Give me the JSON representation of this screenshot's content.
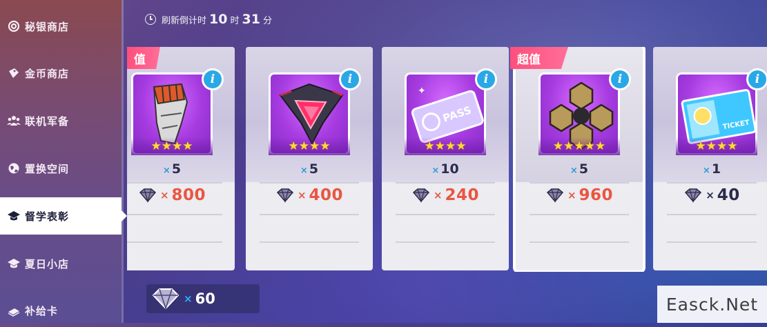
{
  "sidebar": {
    "items": [
      {
        "label": "秘银商店",
        "icon": "spiral-icon"
      },
      {
        "label": "金币商店",
        "icon": "coin-tag-icon"
      },
      {
        "label": "联机军备",
        "icon": "team-icon"
      },
      {
        "label": "置换空间",
        "icon": "globe-icon"
      },
      {
        "label": "督学表彰",
        "icon": "graduation-cap-icon",
        "active": true
      },
      {
        "label": "夏日小店",
        "icon": "graduation-cap-icon"
      },
      {
        "label": "补给卡",
        "icon": "card-stack-icon"
      }
    ]
  },
  "timer": {
    "label": "刷新倒计时",
    "hours": "10",
    "hours_unit": "时",
    "minutes": "31",
    "minutes_unit": "分"
  },
  "cards": [
    {
      "tag": "值",
      "qty_x": "×",
      "qty": "5",
      "stars": "★★★★",
      "price_x": "×",
      "price": "800",
      "item": "orange-helmet-fragment",
      "info": "i"
    },
    {
      "tag": "",
      "qty_x": "×",
      "qty": "5",
      "stars": "★★★★",
      "price_x": "×",
      "price": "400",
      "item": "red-core-device",
      "info": "i"
    },
    {
      "tag": "",
      "qty_x": "×",
      "qty": "10",
      "stars": "★★★★",
      "price_x": "×",
      "price": "240",
      "item": "pass-ticket",
      "info": "i"
    },
    {
      "tag": "超值",
      "qty_x": "×",
      "qty": "5",
      "stars": "★★★★★",
      "price_x": "×",
      "price": "960",
      "item": "hex-gold-material",
      "info": "i"
    },
    {
      "tag": "",
      "qty_x": "×",
      "qty": "1",
      "stars": "★★★★",
      "price_x": "×",
      "price": "40",
      "item": "ticket-card",
      "info": "i"
    }
  ],
  "currency": {
    "times": "×",
    "value": "60",
    "icon": "crystal-icon"
  },
  "watermark": "Easck.Net",
  "colors": {
    "accent_price": "#ea5641",
    "tag": "#ff5d88",
    "info": "#2aa8e6"
  }
}
